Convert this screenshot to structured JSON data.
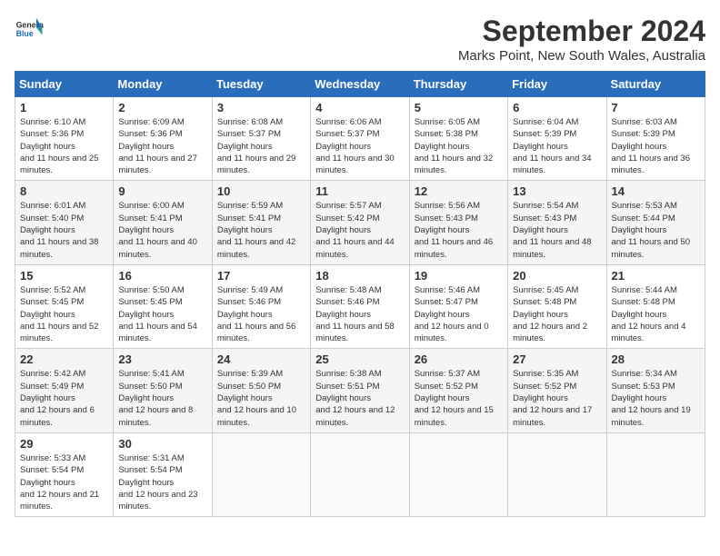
{
  "header": {
    "logo_general": "General",
    "logo_blue": "Blue",
    "month_year": "September 2024",
    "location": "Marks Point, New South Wales, Australia"
  },
  "days_of_week": [
    "Sunday",
    "Monday",
    "Tuesday",
    "Wednesday",
    "Thursday",
    "Friday",
    "Saturday"
  ],
  "weeks": [
    [
      {
        "day": "1",
        "sunrise": "6:10 AM",
        "sunset": "5:36 PM",
        "daylight": "11 hours and 25 minutes."
      },
      {
        "day": "2",
        "sunrise": "6:09 AM",
        "sunset": "5:36 PM",
        "daylight": "11 hours and 27 minutes."
      },
      {
        "day": "3",
        "sunrise": "6:08 AM",
        "sunset": "5:37 PM",
        "daylight": "11 hours and 29 minutes."
      },
      {
        "day": "4",
        "sunrise": "6:06 AM",
        "sunset": "5:37 PM",
        "daylight": "11 hours and 30 minutes."
      },
      {
        "day": "5",
        "sunrise": "6:05 AM",
        "sunset": "5:38 PM",
        "daylight": "11 hours and 32 minutes."
      },
      {
        "day": "6",
        "sunrise": "6:04 AM",
        "sunset": "5:39 PM",
        "daylight": "11 hours and 34 minutes."
      },
      {
        "day": "7",
        "sunrise": "6:03 AM",
        "sunset": "5:39 PM",
        "daylight": "11 hours and 36 minutes."
      }
    ],
    [
      {
        "day": "8",
        "sunrise": "6:01 AM",
        "sunset": "5:40 PM",
        "daylight": "11 hours and 38 minutes."
      },
      {
        "day": "9",
        "sunrise": "6:00 AM",
        "sunset": "5:41 PM",
        "daylight": "11 hours and 40 minutes."
      },
      {
        "day": "10",
        "sunrise": "5:59 AM",
        "sunset": "5:41 PM",
        "daylight": "11 hours and 42 minutes."
      },
      {
        "day": "11",
        "sunrise": "5:57 AM",
        "sunset": "5:42 PM",
        "daylight": "11 hours and 44 minutes."
      },
      {
        "day": "12",
        "sunrise": "5:56 AM",
        "sunset": "5:43 PM",
        "daylight": "11 hours and 46 minutes."
      },
      {
        "day": "13",
        "sunrise": "5:54 AM",
        "sunset": "5:43 PM",
        "daylight": "11 hours and 48 minutes."
      },
      {
        "day": "14",
        "sunrise": "5:53 AM",
        "sunset": "5:44 PM",
        "daylight": "11 hours and 50 minutes."
      }
    ],
    [
      {
        "day": "15",
        "sunrise": "5:52 AM",
        "sunset": "5:45 PM",
        "daylight": "11 hours and 52 minutes."
      },
      {
        "day": "16",
        "sunrise": "5:50 AM",
        "sunset": "5:45 PM",
        "daylight": "11 hours and 54 minutes."
      },
      {
        "day": "17",
        "sunrise": "5:49 AM",
        "sunset": "5:46 PM",
        "daylight": "11 hours and 56 minutes."
      },
      {
        "day": "18",
        "sunrise": "5:48 AM",
        "sunset": "5:46 PM",
        "daylight": "11 hours and 58 minutes."
      },
      {
        "day": "19",
        "sunrise": "5:46 AM",
        "sunset": "5:47 PM",
        "daylight": "12 hours and 0 minutes."
      },
      {
        "day": "20",
        "sunrise": "5:45 AM",
        "sunset": "5:48 PM",
        "daylight": "12 hours and 2 minutes."
      },
      {
        "day": "21",
        "sunrise": "5:44 AM",
        "sunset": "5:48 PM",
        "daylight": "12 hours and 4 minutes."
      }
    ],
    [
      {
        "day": "22",
        "sunrise": "5:42 AM",
        "sunset": "5:49 PM",
        "daylight": "12 hours and 6 minutes."
      },
      {
        "day": "23",
        "sunrise": "5:41 AM",
        "sunset": "5:50 PM",
        "daylight": "12 hours and 8 minutes."
      },
      {
        "day": "24",
        "sunrise": "5:39 AM",
        "sunset": "5:50 PM",
        "daylight": "12 hours and 10 minutes."
      },
      {
        "day": "25",
        "sunrise": "5:38 AM",
        "sunset": "5:51 PM",
        "daylight": "12 hours and 12 minutes."
      },
      {
        "day": "26",
        "sunrise": "5:37 AM",
        "sunset": "5:52 PM",
        "daylight": "12 hours and 15 minutes."
      },
      {
        "day": "27",
        "sunrise": "5:35 AM",
        "sunset": "5:52 PM",
        "daylight": "12 hours and 17 minutes."
      },
      {
        "day": "28",
        "sunrise": "5:34 AM",
        "sunset": "5:53 PM",
        "daylight": "12 hours and 19 minutes."
      }
    ],
    [
      {
        "day": "29",
        "sunrise": "5:33 AM",
        "sunset": "5:54 PM",
        "daylight": "12 hours and 21 minutes."
      },
      {
        "day": "30",
        "sunrise": "5:31 AM",
        "sunset": "5:54 PM",
        "daylight": "12 hours and 23 minutes."
      },
      null,
      null,
      null,
      null,
      null
    ]
  ],
  "labels": {
    "sunrise": "Sunrise:",
    "sunset": "Sunset:",
    "daylight": "Daylight hours"
  }
}
